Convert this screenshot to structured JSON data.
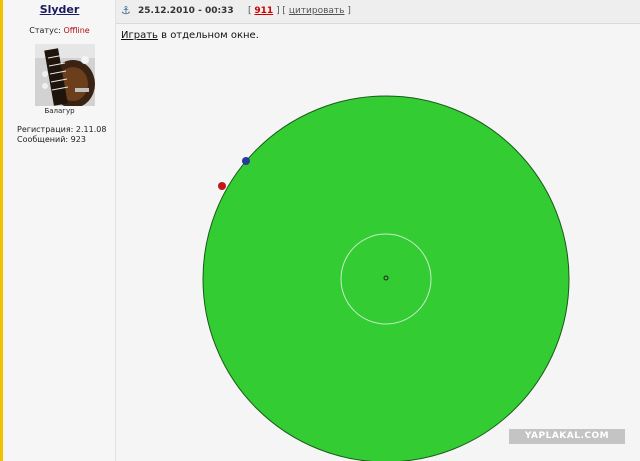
{
  "post": {
    "author": {
      "name": "Slyder",
      "status_label": "Статус:",
      "status_value": "Offline",
      "rank": "Балагур",
      "registration_label": "Регистрация:",
      "registration_value": "2.11.08",
      "messages_label": "Сообщений:",
      "messages_value": "923"
    },
    "header": {
      "anchor_icon": "anchor-icon",
      "datetime": "25.12.2010 - 00:33",
      "bracket_open": "[",
      "post_number": "911",
      "separator": "] [",
      "quote_label": "цитировать",
      "bracket_close": "]"
    },
    "body": {
      "play_link": "Играть",
      "play_suffix": " в отдельном окне."
    }
  },
  "game": {
    "board_color": "#33cc33",
    "player_blue_color": "#2a3a9a",
    "player_red_color": "#c01818"
  },
  "watermark": "YAPLAKAL.COM"
}
